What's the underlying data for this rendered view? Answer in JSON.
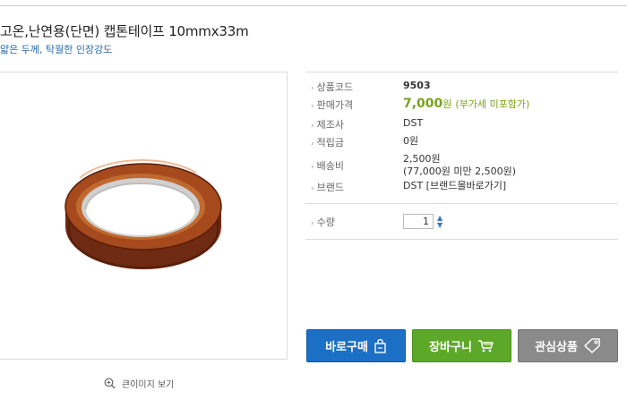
{
  "product": {
    "title": "고온,난연용(단면) 캡톤테이프 10mmx33m",
    "subtitle": "얇은 두께, 탁월한 인장강도"
  },
  "image": {
    "zoom_label": "큰이미지 보기"
  },
  "details": {
    "code": {
      "label": "상품코드",
      "value": "9503"
    },
    "price": {
      "label": "판매가격",
      "amount": "7,000",
      "unit": "원",
      "vat_note": "(부가세 미포함가)"
    },
    "maker": {
      "label": "제조사",
      "value": "DST"
    },
    "points": {
      "label": "적립금",
      "value": "0원"
    },
    "shipping": {
      "label": "배송비",
      "fee": "2,500원",
      "condition": "(77,000원 미만 2,500원)"
    },
    "brand": {
      "label": "브랜드",
      "value": "DST [브랜드몰바로가기]"
    },
    "quantity": {
      "label": "수량",
      "value": "1"
    }
  },
  "buttons": {
    "buy": "바로구매",
    "cart": "장바구니",
    "wish": "관심상품"
  },
  "colors": {
    "code": "#c81e1e",
    "price": "#78a21a",
    "buy": "#1b6fc4",
    "cart": "#5ea829",
    "wish": "#8a8a8a",
    "subtitle": "#2b6aa8"
  },
  "icons": {
    "zoom": "magnifier-plus-icon",
    "buy": "shopping-bag-icon",
    "cart": "cart-icon",
    "wish": "tag-icon",
    "quantity": "up-down-chevron-icon"
  }
}
